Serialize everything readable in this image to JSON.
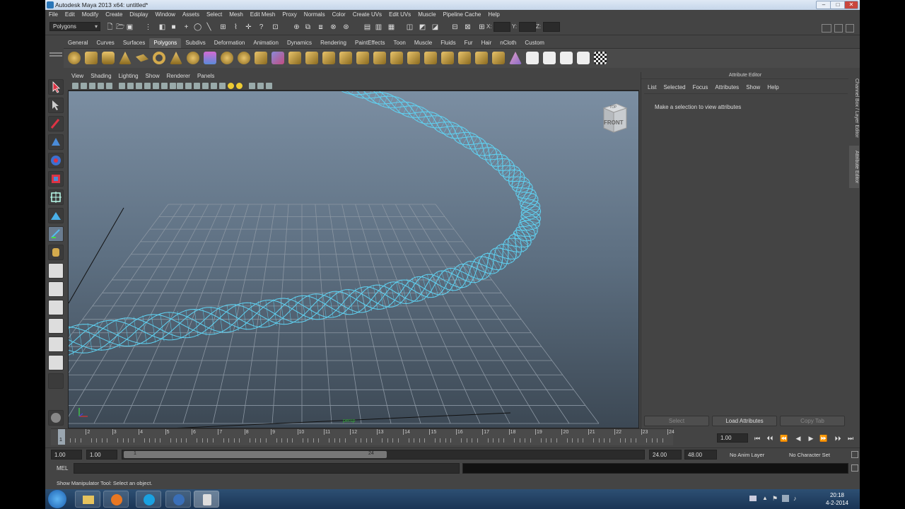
{
  "window": {
    "title": "Autodesk Maya 2013 x64: untitled*"
  },
  "menu": [
    "File",
    "Edit",
    "Modify",
    "Create",
    "Display",
    "Window",
    "Assets",
    "Select",
    "Mesh",
    "Edit Mesh",
    "Proxy",
    "Normals",
    "Color",
    "Create UVs",
    "Edit UVs",
    "Muscle",
    "Pipeline Cache",
    "Help"
  ],
  "status_line": {
    "mode": "Polygons",
    "x_label": "X:",
    "y_label": "Y:",
    "z_label": "Z:"
  },
  "shelf_tabs": [
    "General",
    "Curves",
    "Surfaces",
    "Polygons",
    "Subdivs",
    "Deformation",
    "Animation",
    "Dynamics",
    "Rendering",
    "PaintEffects",
    "Toon",
    "Muscle",
    "Fluids",
    "Fur",
    "Hair",
    "nCloth",
    "Custom"
  ],
  "shelf_active": "Polygons",
  "viewport": {
    "menu": [
      "View",
      "Shading",
      "Lighting",
      "Show",
      "Renderer",
      "Panels"
    ],
    "view_cube_label": "FRONT",
    "view_cube_top": "TOP",
    "camera_label": "persp",
    "colors": {
      "wire": "#5fd3f3",
      "grid": "#8c97a3"
    }
  },
  "attribute_editor": {
    "title": "Attribute Editor",
    "menu": [
      "List",
      "Selected",
      "Focus",
      "Attributes",
      "Show",
      "Help"
    ],
    "message": "Make a selection to view attributes",
    "buttons": {
      "select": "Select",
      "load": "Load Attributes",
      "copy": "Copy Tab"
    }
  },
  "side_tabs": {
    "channel_box": "Channel Box / Layer Editor",
    "attribute_editor": "Attribute Editor"
  },
  "time_slider": {
    "ticks": [
      "1",
      "2",
      "3",
      "4",
      "5",
      "6",
      "7",
      "8",
      "9",
      "10",
      "11",
      "12",
      "13",
      "14",
      "15",
      "16",
      "17",
      "18",
      "19",
      "20",
      "21",
      "22",
      "23",
      "24"
    ],
    "current_time": "1.00",
    "current_frame": "1"
  },
  "range_slider": {
    "start": "1.00",
    "playback_start": "1.00",
    "range_start_label": "1",
    "range_end_label": "24",
    "playback_end": "24.00",
    "end": "48.00",
    "anim_layer": "No Anim Layer",
    "character_set": "No Character Set"
  },
  "command_line": {
    "label": "MEL"
  },
  "help_line": {
    "text": "Show Manipulator Tool: Select an object."
  },
  "taskbar": {
    "time": "20:18",
    "date": "4-2-2014"
  }
}
